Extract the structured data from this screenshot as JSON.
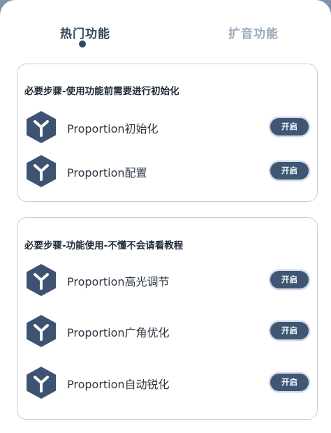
{
  "tabs": [
    {
      "label": "热门功能",
      "active": true
    },
    {
      "label": "扩音功能",
      "active": false
    }
  ],
  "sections": [
    {
      "title": "必要步骤-使用功能前需要进行初始化",
      "items": [
        {
          "label": "Proportion初始化",
          "button": "开启",
          "icon": "hexagon-y-icon"
        },
        {
          "label": "Proportion配置",
          "button": "开启",
          "icon": "hexagon-y-icon"
        }
      ]
    },
    {
      "title": "必要步骤-功能使用-不懂不会请看教程",
      "items": [
        {
          "label": "Proportion高光调节",
          "button": "开启",
          "icon": "hexagon-y-icon"
        },
        {
          "label": "Proportion广角优化",
          "button": "开启",
          "icon": "hexagon-y-icon"
        },
        {
          "label": "Proportion自动锐化",
          "button": "开启",
          "icon": "hexagon-y-icon"
        }
      ]
    }
  ],
  "colors": {
    "accent": "#3f5675",
    "icon": "#3e5372",
    "tab_active": "#34495f",
    "tab_inactive": "#9aa9bc",
    "backdrop": "#7d93ad"
  }
}
